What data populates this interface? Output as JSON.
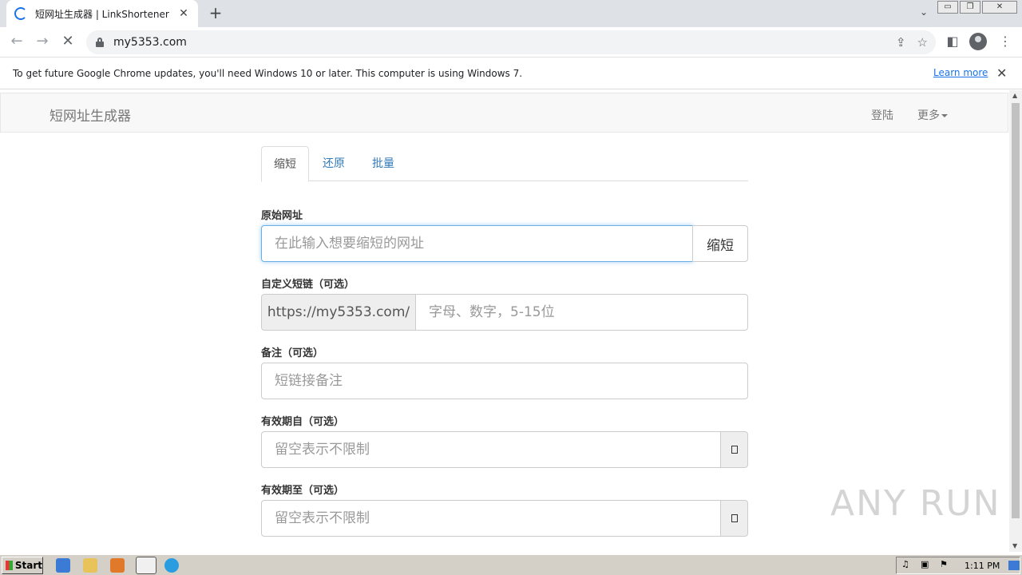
{
  "browser": {
    "tab_title": "短网址生成器 | LinkShortener",
    "url": "my5353.com",
    "infobar_message": "To get future Google Chrome updates, you'll need Windows 10 or later. This computer is using Windows 7.",
    "infobar_link": "Learn more"
  },
  "navbar": {
    "brand": "短网址生成器",
    "login": "登陆",
    "more": "更多"
  },
  "tabs": [
    {
      "label": "缩短",
      "active": true
    },
    {
      "label": "还原",
      "active": false
    },
    {
      "label": "批量",
      "active": false
    }
  ],
  "form": {
    "original_url_label": "原始网址",
    "original_url_placeholder": "在此输入想要缩短的网址",
    "shorten_button": "缩短",
    "custom_label": "自定义短链（可选）",
    "custom_prefix": "https://my5353.com/",
    "custom_placeholder": "字母、数字，5-15位",
    "note_label": "备注（可选）",
    "note_placeholder": "短链接备注",
    "valid_from_label": "有效期自（可选）",
    "valid_from_placeholder": "留空表示不限制",
    "valid_to_label": "有效期至（可选）",
    "valid_to_placeholder": "留空表示不限制"
  },
  "watermark": "ANY RUN",
  "taskbar": {
    "start": "Start",
    "clock": "1:11 PM"
  }
}
